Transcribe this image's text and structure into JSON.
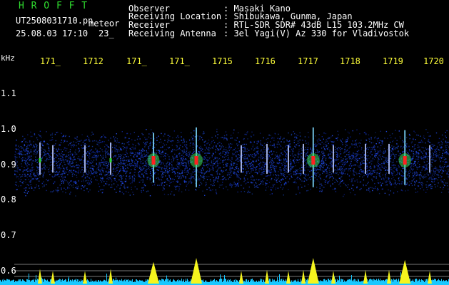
{
  "header": {
    "app_name": "H R O F F T",
    "filename": "UT2508031710.pn",
    "mode": "meteor",
    "date_time": "25.08.03 17:10",
    "count": "23_",
    "observer_label": "Observer",
    "observer_value": ": Masaki Kano",
    "location_label": "Receiving Location",
    "location_value": ": Shibukawa, Gunma, Japan",
    "receiver_label": "Receiver",
    "receiver_value": ": RTL-SDR SDR# 43dB L15 103.2MHz CW",
    "antenna_label": "Receiving Antenna",
    "antenna_value": ": 3el Yagi(V) Az 330 for Vladivostok"
  },
  "time_axis": [
    "171_",
    "1712",
    "171_",
    "171_",
    "1715",
    "1716",
    "1717",
    "1718",
    "1719",
    "1720"
  ],
  "freq_axis": {
    "unit": "kHz",
    "labels": [
      "1.1",
      "1.0",
      "0.9",
      "0.8",
      "0.7",
      "0.6"
    ]
  },
  "colors": {
    "background": "#000000",
    "title_green": "#2fdc2f",
    "time_label_yellow": "#ffff3a",
    "noise_blue": "#1e3cc8",
    "signal_red": "#ff2020",
    "baseline_cyan": "#19c8ff",
    "trace_yellow": "#f5f51e"
  },
  "chart_data": {
    "type": "heatmap",
    "title": "",
    "xlabel": "",
    "ylabel": "kHz",
    "x_ticks": [
      "171_",
      "1712",
      "171_",
      "171_",
      "1715",
      "1716",
      "1717",
      "1718",
      "1719",
      "1720"
    ],
    "y_ticks": [
      1.1,
      1.0,
      0.9,
      0.8,
      0.7,
      0.6
    ],
    "ylim": [
      0.58,
      1.16
    ],
    "noise_band": [
      0.81,
      1.0
    ],
    "carrier_freq": 0.91,
    "events": [
      {
        "time_min": 1710.6,
        "strength": 0.45
      },
      {
        "time_min": 1710.9,
        "strength": 0.35
      },
      {
        "time_min": 1711.65,
        "strength": 0.35
      },
      {
        "time_min": 1712.25,
        "strength": 0.45
      },
      {
        "time_min": 1713.25,
        "strength": 0.8
      },
      {
        "time_min": 1714.25,
        "strength": 1.0
      },
      {
        "time_min": 1715.3,
        "strength": 0.35
      },
      {
        "time_min": 1715.9,
        "strength": 0.4
      },
      {
        "time_min": 1716.4,
        "strength": 0.35
      },
      {
        "time_min": 1716.75,
        "strength": 0.4
      },
      {
        "time_min": 1716.98,
        "strength": 1.0
      },
      {
        "time_min": 1717.45,
        "strength": 0.35
      },
      {
        "time_min": 1718.2,
        "strength": 0.4
      },
      {
        "time_min": 1718.75,
        "strength": 0.4
      },
      {
        "time_min": 1719.12,
        "strength": 0.9
      },
      {
        "time_min": 1719.7,
        "strength": 0.35
      }
    ]
  }
}
